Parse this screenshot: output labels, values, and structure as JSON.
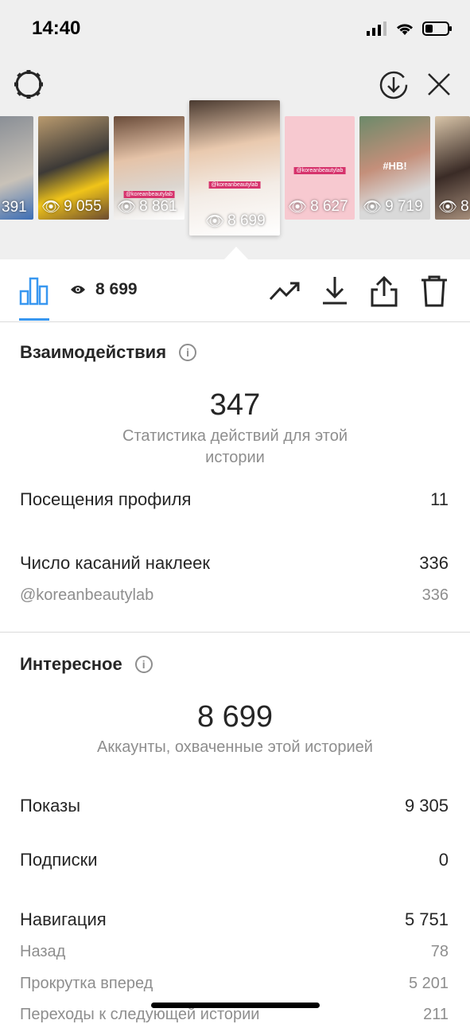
{
  "status_bar": {
    "time": "14:40"
  },
  "stories": [
    {
      "views": "391",
      "tag": ""
    },
    {
      "views": "9 055",
      "tag": ""
    },
    {
      "views": "8 861",
      "tag": "@koreanbeautylab"
    },
    {
      "views": "8 699",
      "tag": "@koreanbeautylab",
      "selected": true
    },
    {
      "views": "8 627",
      "tag": "@koreanbeautylab"
    },
    {
      "views": "9 719",
      "tag": "#НВ!"
    },
    {
      "views": "8",
      "tag": ""
    }
  ],
  "toolbar": {
    "views": "8 699"
  },
  "interactions": {
    "title": "Взаимодействия",
    "total": "347",
    "total_label": "Статистика действий для этой истории",
    "rows": [
      {
        "label": "Посещения профиля",
        "value": "11"
      },
      {
        "label": "Число касаний наклеек",
        "value": "336"
      },
      {
        "label": "@koreanbeautylab",
        "value": "336"
      }
    ]
  },
  "discovery": {
    "title": "Интересное",
    "total": "8 699",
    "total_label": "Аккаунты, охваченные этой историей",
    "rows": [
      {
        "label": "Показы",
        "value": "9 305"
      },
      {
        "label": "Подписки",
        "value": "0"
      },
      {
        "label": "Навигация",
        "value": "5 751"
      },
      {
        "label": "Назад",
        "value": "78"
      },
      {
        "label": "Прокрутка вперед",
        "value": "5 201"
      },
      {
        "label": "Переходы к следующей истории",
        "value": "211"
      }
    ]
  },
  "colors": {
    "accent": "#3897f0",
    "secondary_text": "#8e8e8e"
  }
}
